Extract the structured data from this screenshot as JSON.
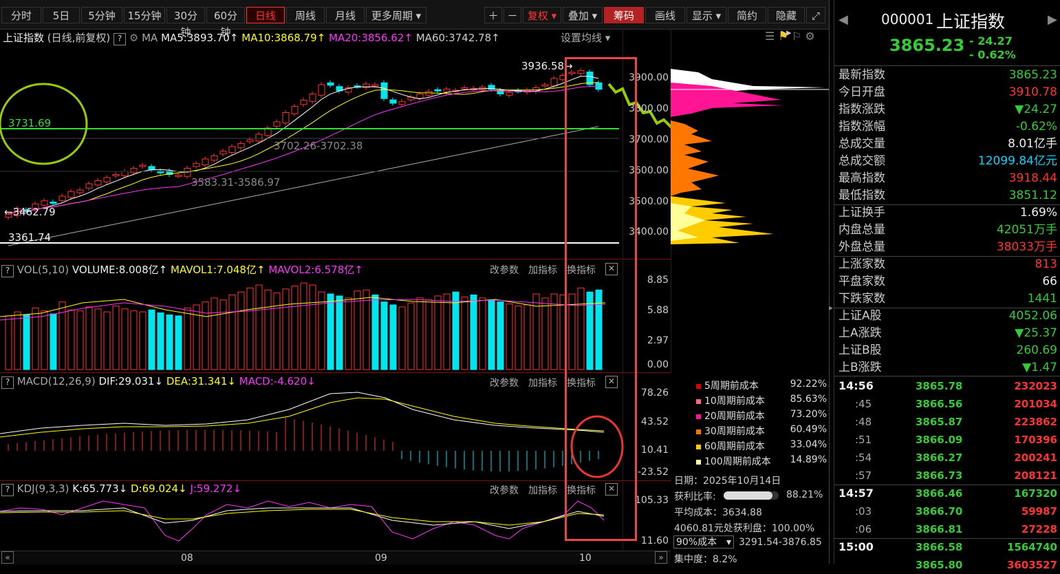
{
  "toolbar": {
    "periods": [
      "分时",
      "5日",
      "5分钟",
      "15分钟",
      "30分钟",
      "60分钟",
      "日线",
      "周线",
      "月线",
      "更多周期"
    ],
    "active_period": "日线",
    "fuquan": "复权",
    "diejia": "叠加",
    "chouma": "筹码",
    "huaxian": "画线",
    "xianshi": "显示",
    "jianyue": "简约",
    "yincang": "隐藏"
  },
  "main_chart": {
    "title": "上证指数",
    "subtitle": "(日线,前复权)",
    "ma_label": "MA",
    "ma5": "MA5:3893.70",
    "ma10": "MA10:3868.79",
    "ma20": "MA20:3856.62",
    "ma60": "MA60:3742.78",
    "settings": "设置均线",
    "high_label": "3936.58",
    "level_label": "3731.69",
    "gap1": "3702.26-3702.38",
    "gap2": "3583.31-3586.97",
    "low_label": "3462.79",
    "bottom_label": "3361.74",
    "y_ticks": [
      "3900.00",
      "3800.00",
      "3700.00",
      "3600.00",
      "3500.00",
      "3400.00"
    ]
  },
  "vol": {
    "label": "VOL(5,10)",
    "volume": "VOLUME:8.008亿",
    "mavol1": "MAVOL1:7.048亿",
    "mavol2": "MAVOL2:6.578亿",
    "y_ticks": [
      "8.85",
      "5.88",
      "2.97",
      "0.00"
    ]
  },
  "macd": {
    "label": "MACD(12,26,9)",
    "dif": "DIF:29.031",
    "dea": "DEA:31.341",
    "macd": "MACD:-4.620",
    "y_ticks": [
      "78.26",
      "43.52",
      "10.41",
      "-23.52"
    ]
  },
  "kdj": {
    "label": "KDJ(9,3,3)",
    "k": "K:65.773",
    "d": "D:69.024",
    "j": "J:59.272",
    "y_ticks": [
      "105.33",
      "11.60"
    ]
  },
  "panel_buttons": {
    "params": "改参数",
    "add": "加指标",
    "switch": "换指标"
  },
  "x_axis": [
    "08",
    "09",
    "10"
  ],
  "chip": {
    "rows": [
      {
        "label": "5周期前成本",
        "value": "92.22%",
        "color": "#dd0000"
      },
      {
        "label": "10周期前成本",
        "value": "85.63%",
        "color": "#ff6680"
      },
      {
        "label": "20周期前成本",
        "value": "73.20%",
        "color": "#ff1493"
      },
      {
        "label": "30周期前成本",
        "value": "60.49%",
        "color": "#ff7700"
      },
      {
        "label": "60周期前成本",
        "value": "33.04%",
        "color": "#ffcc00"
      },
      {
        "label": "100周期前成本",
        "value": "14.89%",
        "color": "#ffff99"
      }
    ],
    "date": "日期：2025年10月14日",
    "profit_label": "获利比率:",
    "profit_value": "88.21%",
    "profit_ratio": 0.8821,
    "avg_cost": "平均成本：3634.88",
    "profit_at": "4060.81元处获利盘：100.00%",
    "cost90_select": "90%成本",
    "cost90_range": "3291.54-3876.85",
    "concentration": "集中度：8.2%"
  },
  "right_panel": {
    "code": "000001",
    "name": "上证指数",
    "price": "3865.23",
    "change": "- 24.27",
    "change_pct": "- 0.62%",
    "stats": [
      {
        "k": "最新指数",
        "v": "3865.23",
        "c": "#33cc33"
      },
      {
        "k": "今日开盘",
        "v": "3910.78",
        "c": "#ff3333"
      },
      {
        "k": "指数涨跌",
        "v": "▼24.27",
        "c": "#33cc33"
      },
      {
        "k": "指数涨幅",
        "v": "-0.62%",
        "c": "#33cc33"
      },
      {
        "k": "总成交量",
        "v": "8.01亿手",
        "c": "#eeeeee"
      },
      {
        "k": "总成交额",
        "v": "12099.84亿元",
        "c": "#00d4ff"
      },
      {
        "k": "最高指数",
        "v": "3918.44",
        "c": "#ff3333"
      },
      {
        "k": "最低指数",
        "v": "3851.12",
        "c": "#33cc33"
      },
      {
        "k": "上证换手",
        "v": "1.69%",
        "c": "#eeeeee"
      },
      {
        "k": "内盘总量",
        "v": "42051万手",
        "c": "#33cc33"
      },
      {
        "k": "外盘总量",
        "v": "38033万手",
        "c": "#ff3333"
      },
      {
        "k": "上涨家数",
        "v": "813",
        "c": "#ff3333"
      },
      {
        "k": "平盘家数",
        "v": "66",
        "c": "#eeeeee"
      },
      {
        "k": "下跌家数",
        "v": "1441",
        "c": "#33cc33"
      },
      {
        "k": "上证A股",
        "v": "4052.06",
        "c": "#33cc33"
      },
      {
        "k": "上A涨跌",
        "v": "▼25.37",
        "c": "#33cc33"
      },
      {
        "k": "上证B股",
        "v": "260.69",
        "c": "#33cc33"
      },
      {
        "k": "上B涨跌",
        "v": "▼1.47",
        "c": "#33cc33"
      }
    ],
    "ticks": [
      {
        "t": "14:56",
        "p": "3865.78",
        "v": "232023",
        "vc": "#ff3333",
        "bold": true
      },
      {
        "t": ":45",
        "p": "3866.56",
        "v": "201034",
        "vc": "#ff3333"
      },
      {
        "t": ":48",
        "p": "3865.87",
        "v": "223862",
        "vc": "#ff3333"
      },
      {
        "t": ":51",
        "p": "3866.09",
        "v": "170396",
        "vc": "#ff3333"
      },
      {
        "t": ":54",
        "p": "3866.27",
        "v": "200241",
        "vc": "#ff3333"
      },
      {
        "t": ":57",
        "p": "3866.73",
        "v": "208121",
        "vc": "#ff3333"
      },
      {
        "t": "14:57",
        "p": "3866.46",
        "v": "167320",
        "vc": "#33cc33",
        "bold": true
      },
      {
        "t": ":03",
        "p": "3866.70",
        "v": "59987",
        "vc": "#ff3333"
      },
      {
        "t": ":06",
        "p": "3866.81",
        "v": "27228",
        "vc": "#ff3333"
      },
      {
        "t": "15:00",
        "p": "3866.58",
        "v": "1564740",
        "vc": "#33cc33",
        "bold": true
      },
      {
        "t": "",
        "p": "3865.80",
        "v": "3603527",
        "vc": "#ff3333"
      }
    ]
  },
  "colors": {
    "up": "#ff3333",
    "down": "#00e5ee",
    "ma5": "#ffffff",
    "ma10": "#ffff00",
    "ma20": "#ff33ff",
    "ma60": "#aaaaaa",
    "highlight": "#ee4444",
    "level": "#33dd33",
    "circle": "#99cc00"
  },
  "chart_data": {
    "type": "candlestick",
    "series_close": [
      3462,
      3480,
      3470,
      3495,
      3505,
      3500,
      3520,
      3535,
      3540,
      3560,
      3570,
      3580,
      3590,
      3600,
      3610,
      3620,
      3605,
      3595,
      3590,
      3588,
      3610,
      3625,
      3640,
      3650,
      3665,
      3680,
      3690,
      3702,
      3720,
      3740,
      3760,
      3790,
      3810,
      3830,
      3850,
      3880,
      3878,
      3860,
      3870,
      3875,
      3882,
      3880,
      3835,
      3820,
      3825,
      3840,
      3850,
      3858,
      3860,
      3866,
      3862,
      3870,
      3868,
      3872,
      3865,
      3850,
      3855,
      3860,
      3862,
      3870,
      3880,
      3900,
      3910,
      3920,
      3925,
      3880,
      3865
    ],
    "vol": [
      5.4,
      5.8,
      5.5,
      6.2,
      5.9,
      5.6,
      6.8,
      6.0,
      5.9,
      6.3,
      6.1,
      5.8,
      6.4,
      6.1,
      5.9,
      5.8,
      6.0,
      5.7,
      5.5,
      5.4,
      6.2,
      6.5,
      6.8,
      7.2,
      7.0,
      7.5,
      7.8,
      8.2,
      8.5,
      8.0,
      7.7,
      8.1,
      8.4,
      8.7,
      8.5,
      7.8,
      7.6,
      7.4,
      7.2,
      7.9,
      8.0,
      7.5,
      6.8,
      6.5,
      6.3,
      6.7,
      7.2,
      7.0,
      7.4,
      7.6,
      7.8,
      7.3,
      7.5,
      7.2,
      7.0,
      6.8,
      6.6,
      6.4,
      6.5,
      7.6,
      7.2,
      7.6,
      7.5,
      7.6,
      8.2,
      7.8,
      8.0
    ]
  }
}
